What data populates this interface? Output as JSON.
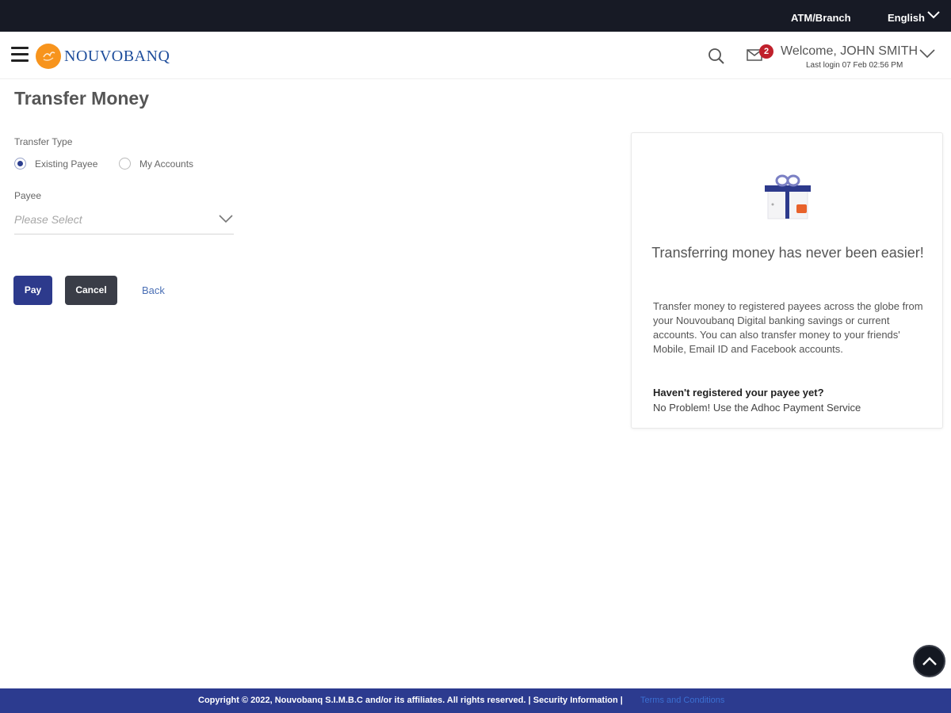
{
  "topbar": {
    "atm_branch": "ATM/Branch",
    "language": "English"
  },
  "header": {
    "logo_text": "NOUVOBANQ",
    "mail_badge_count": "2",
    "welcome": "Welcome, JOHN SMITH",
    "last_login": "Last login 07 Feb 02:56 PM",
    "icons": [
      "hamburger-menu-icon",
      "bank-logo-icon",
      "search-icon",
      "mail-icon",
      "chevron-down-icon"
    ]
  },
  "page": {
    "title": "Transfer Money"
  },
  "form": {
    "transfer_type_label": "Transfer Type",
    "options": [
      {
        "label": "Existing Payee",
        "selected": true
      },
      {
        "label": "My Accounts",
        "selected": false
      }
    ],
    "payee_label": "Payee",
    "payee_placeholder": "Please Select",
    "buttons": {
      "pay": "Pay",
      "cancel": "Cancel",
      "back": "Back"
    }
  },
  "info_card": {
    "heading": "Transferring money has never been easier!",
    "body": "Transfer money to registered payees across the globe from your Nouvoubanq Digital banking savings or current accounts. You can also transfer money to your friends' Mobile, Email ID and Facebook accounts.",
    "question": "Haven't registered your payee yet?",
    "answer": "No Problem! Use the Adhoc Payment Service"
  },
  "footer": {
    "copyright": "Copyright © 2022, Nouvobanq S.I.M.B.C and/or its affiliates. All rights reserved. | Security Information |",
    "terms_link": "Terms and Conditions"
  },
  "colors": {
    "topbar": "#171a25",
    "primary": "#2d3a8c",
    "secondary_button": "#3a3d47",
    "logo_orange": "#f7941d",
    "badge_red": "#c0202b",
    "footer": "#2c3b8f"
  }
}
